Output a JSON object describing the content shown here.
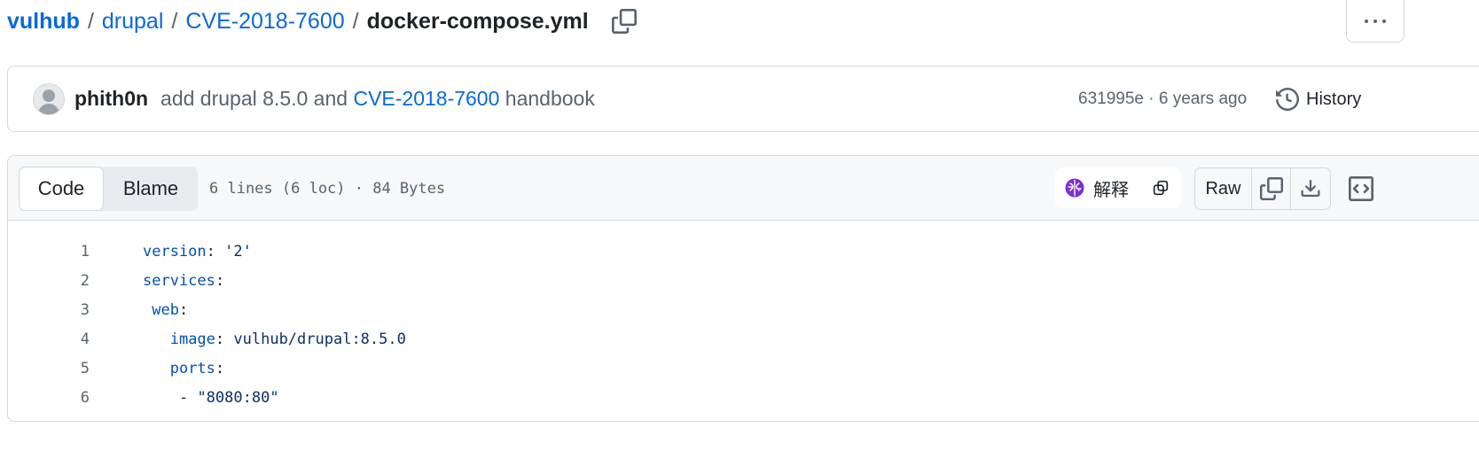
{
  "breadcrumb": {
    "repo": "vulhub",
    "dir1": "drupal",
    "dir2": "CVE-2018-7600",
    "file": "docker-compose.yml",
    "separator": "/"
  },
  "commit": {
    "author": "phith0n",
    "message_prefix": "add drupal 8.5.0 and ",
    "message_link": "CVE-2018-7600",
    "message_suffix": " handbook",
    "meta": "631995e · 6 years ago",
    "history_label": "History"
  },
  "file_header": {
    "tabs": [
      "Code",
      "Blame"
    ],
    "info": "6 lines (6 loc) · 84 Bytes",
    "explain_label": "解释",
    "raw_label": "Raw"
  },
  "code": {
    "lines": [
      {
        "num": "1",
        "indent": "",
        "key": "version",
        "sep": ": ",
        "value": "'2'"
      },
      {
        "num": "2",
        "indent": "",
        "key": "services",
        "sep": ":",
        "value": ""
      },
      {
        "num": "3",
        "indent": " ",
        "key": "web",
        "sep": ":",
        "value": ""
      },
      {
        "num": "4",
        "indent": "   ",
        "key": "image",
        "sep": ": ",
        "value": "vulhub/drupal:8.5.0"
      },
      {
        "num": "5",
        "indent": "   ",
        "key": "ports",
        "sep": ":",
        "value": ""
      },
      {
        "num": "6",
        "indent": "    ",
        "key": "",
        "sep": "- ",
        "value": "\"8080:80\""
      }
    ]
  },
  "colors": {
    "link": "#0969da",
    "muted": "#59636e",
    "border": "#d1d9e0",
    "header_bg": "#f6f8fa",
    "brain_icon": "#8a2be2"
  }
}
